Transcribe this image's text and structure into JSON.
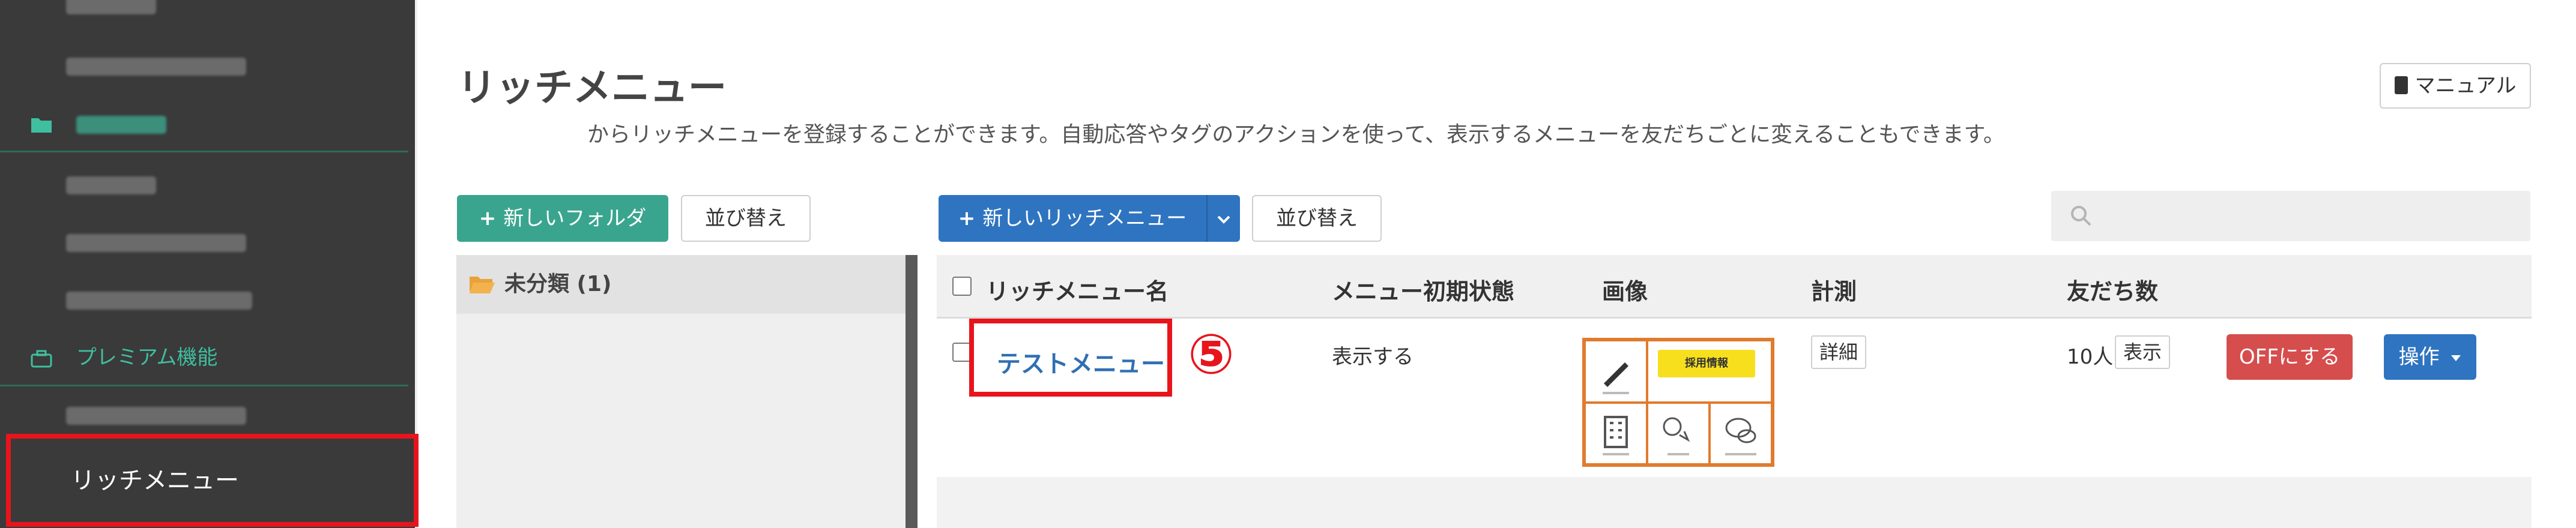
{
  "sidebar": {
    "items_top": [
      {
        "label": "サイトスクリプト",
        "blurred": true
      }
    ],
    "category_contents": {
      "label": "コンテンツ",
      "icon": "folder-icon"
    },
    "contents_items": [
      {
        "label": "共通情報",
        "blurred": true
      },
      {
        "label": "登録メディア一覧",
        "blurred": true
      },
      {
        "label": "QRコード作成",
        "blurred": true
      }
    ],
    "category_premium": {
      "label": "プレミアム機能",
      "icon": "premium-icon"
    },
    "premium_items": [
      {
        "label": "ダッシュボード",
        "blurred": true
      }
    ],
    "active_item": {
      "label": "リッチメニュー"
    }
  },
  "header": {
    "title": "リッチメニュー",
    "description": "からリッチメニューを登録することができます。自動応答やタグのアクションを使って、表示するメニューを友だちごとに変えることもできます。",
    "manual_label": "マニュアル"
  },
  "folders": {
    "new_folder_label": "新しいフォルダ",
    "sort_label": "並び替え",
    "items": [
      {
        "label": "未分類 (1)"
      }
    ]
  },
  "rich_menu": {
    "new_label": "新しいリッチメニュー",
    "sort_label": "並び替え",
    "search_placeholder": ""
  },
  "table": {
    "headers": {
      "name": "リッチメニュー名",
      "initial_state": "メニュー初期状態",
      "image": "画像",
      "measurement": "計測",
      "friends": "友だち数"
    },
    "rows": [
      {
        "name": "テストメニュー",
        "initial_state": "表示する",
        "measurement_button": "詳細",
        "friends_count": "10人",
        "friends_button": "表示",
        "off_button": "OFFにする",
        "action_button": "操作",
        "thumbnail_banner": "採用情報"
      }
    ]
  },
  "annotation": {
    "step_number": "⑤"
  },
  "colors": {
    "sidebar_bg": "#3a3a3a",
    "accent_green": "#3aa58f",
    "accent_blue": "#2f74c0",
    "highlight_red": "#e8141c",
    "off_red": "#d64d4d"
  }
}
